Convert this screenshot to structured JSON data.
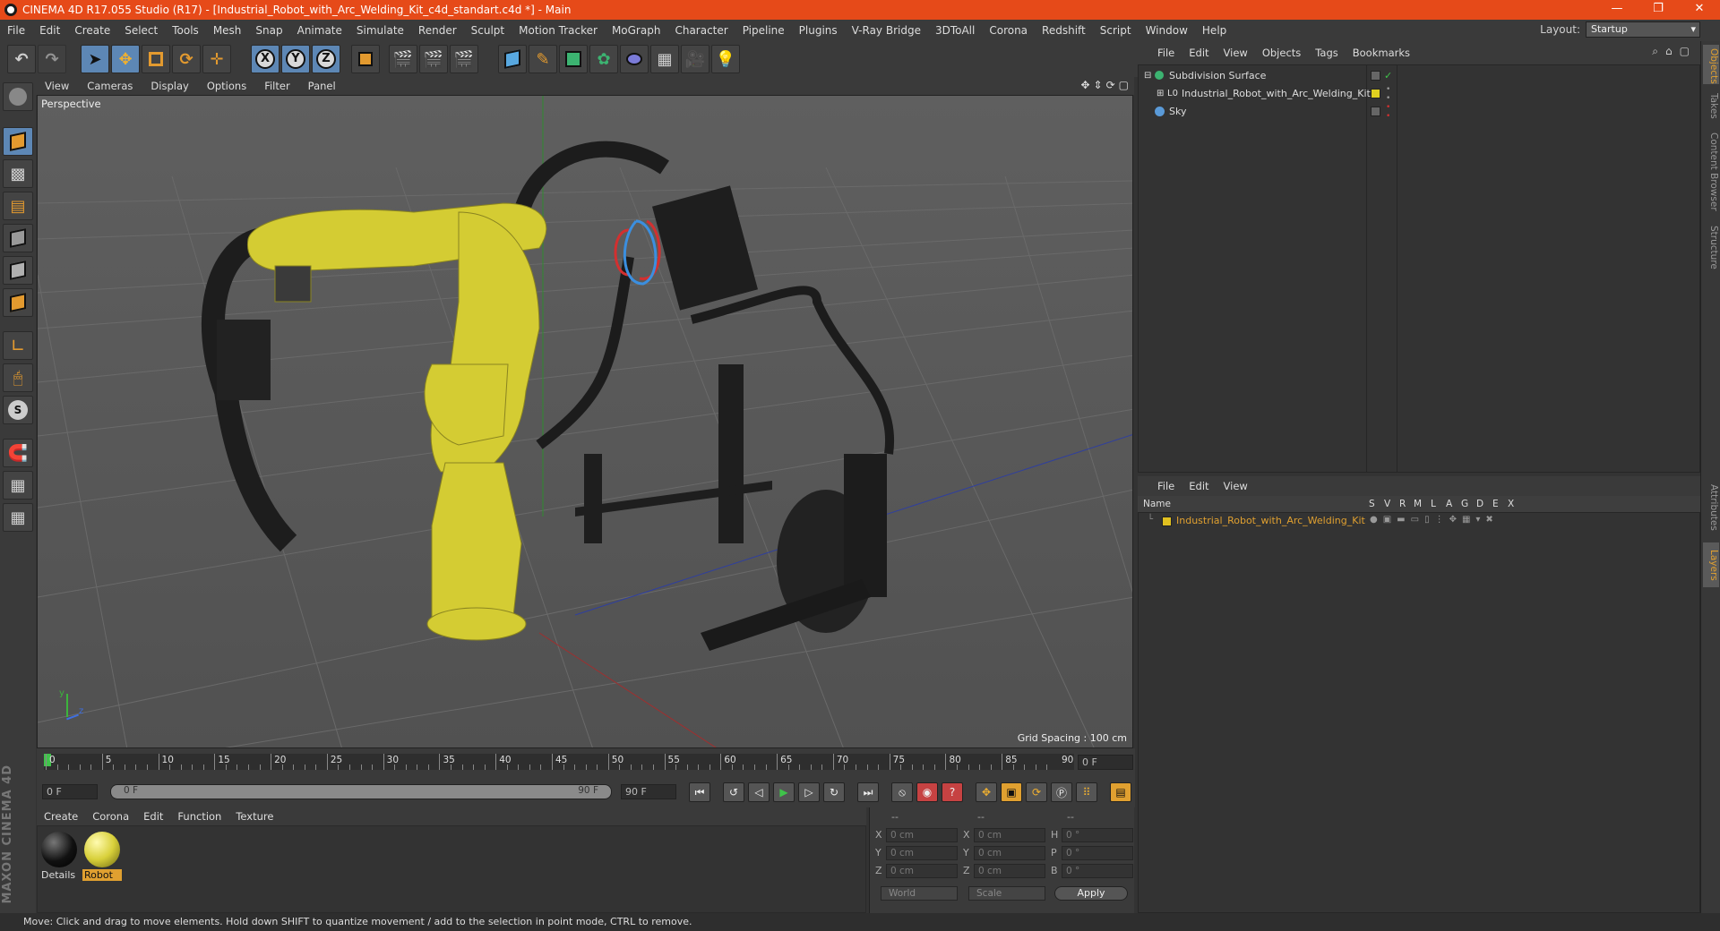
{
  "window": {
    "title": "CINEMA 4D R17.055 Studio (R17) - [Industrial_Robot_with_Arc_Welding_Kit_c4d_standart.c4d *] - Main",
    "minimize": "—",
    "restore": "❐",
    "close": "✕"
  },
  "menu": {
    "items": [
      "File",
      "Edit",
      "Create",
      "Select",
      "Tools",
      "Mesh",
      "Snap",
      "Animate",
      "Simulate",
      "Render",
      "Sculpt",
      "Motion Tracker",
      "MoGraph",
      "Character",
      "Pipeline",
      "Plugins",
      "V-Ray Bridge",
      "3DToAll",
      "Corona",
      "Redshift",
      "Script",
      "Window",
      "Help"
    ],
    "layout_label": "Layout:",
    "layout_value": "Startup"
  },
  "toolbar": {
    "axis_x": "X",
    "axis_y": "Y",
    "axis_z": "Z"
  },
  "viewport": {
    "menu": [
      "View",
      "Cameras",
      "Display",
      "Options",
      "Filter",
      "Panel"
    ],
    "label": "Perspective",
    "grid_spacing": "Grid Spacing : 100 cm",
    "axis_y": "y",
    "axis_z": "z"
  },
  "timeline": {
    "ticks": [
      "0",
      "5",
      "10",
      "15",
      "20",
      "25",
      "30",
      "35",
      "40",
      "45",
      "50",
      "55",
      "60",
      "65",
      "70",
      "75",
      "80",
      "85",
      "90"
    ],
    "current_frame": "0 F",
    "start_field": "0 F",
    "range_start": "0 F",
    "range_end": "90 F",
    "end_field": "90 F"
  },
  "materials": {
    "menu": [
      "Create",
      "Corona",
      "Edit",
      "Function",
      "Texture"
    ],
    "items": [
      {
        "name": "Details",
        "selected": false,
        "color": "#111111"
      },
      {
        "name": "Robot",
        "selected": true,
        "color": "#d8d03a"
      }
    ]
  },
  "coordinates": {
    "headers": [
      "--",
      "--",
      "--"
    ],
    "rows": [
      {
        "l1": "X",
        "v1": "0 cm",
        "l2": "X",
        "v2": "0 cm",
        "l3": "H",
        "v3": "0 °"
      },
      {
        "l1": "Y",
        "v1": "0 cm",
        "l2": "Y",
        "v2": "0 cm",
        "l3": "P",
        "v3": "0 °"
      },
      {
        "l1": "Z",
        "v1": "0 cm",
        "l2": "Z",
        "v2": "0 cm",
        "l3": "B",
        "v3": "0 °"
      }
    ],
    "space": "World",
    "mode": "Scale",
    "apply": "Apply"
  },
  "object_manager": {
    "menu": [
      "File",
      "Edit",
      "View",
      "Objects",
      "Tags",
      "Bookmarks"
    ],
    "objects": [
      {
        "name": "Subdivision Surface",
        "indent": 0
      },
      {
        "name": "Industrial_Robot_with_Arc_Welding_Kit",
        "indent": 1
      },
      {
        "name": "Sky",
        "indent": 0
      }
    ]
  },
  "layer_manager": {
    "menu": [
      "File",
      "Edit",
      "View"
    ],
    "columns": [
      "Name",
      "S",
      "V",
      "R",
      "M",
      "L",
      "A",
      "G",
      "D",
      "E",
      "X"
    ],
    "layers": [
      {
        "name": "Industrial_Robot_with_Arc_Welding_Kit",
        "color": "#e0c020"
      }
    ]
  },
  "right_tabs": [
    "Objects",
    "Takes",
    "Content Browser",
    "Structure",
    "Attributes",
    "Layers"
  ],
  "status": "Move: Click and drag to move elements. Hold down SHIFT to quantize movement / add to the selection in point mode, CTRL to remove.",
  "brand": "MAXON CINEMA 4D",
  "colors": {
    "accent": "#e64a19",
    "highlight": "#e0a030",
    "robot": "#d8d03a"
  }
}
